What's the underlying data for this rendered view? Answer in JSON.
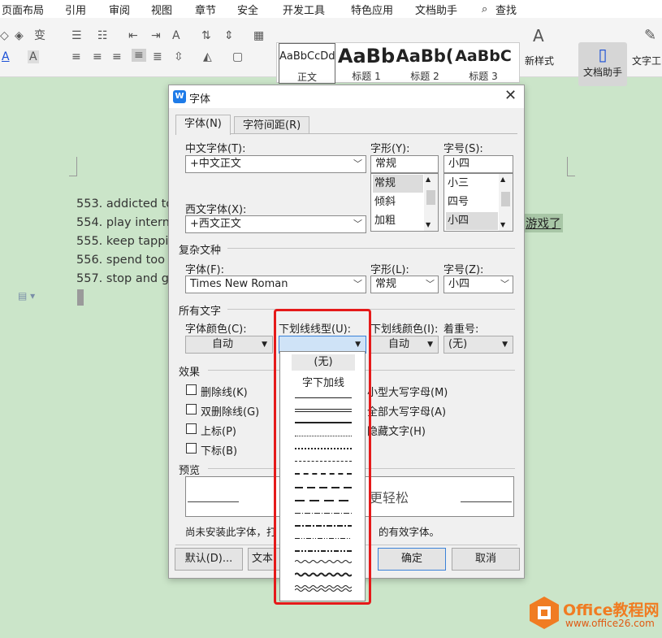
{
  "menu": [
    "页面布局",
    "引用",
    "审阅",
    "视图",
    "章节",
    "安全",
    "开发工具",
    "特色应用",
    "文档助手",
    "查找"
  ],
  "styles": [
    {
      "preview": "AaBbCcDd",
      "name": "正文"
    },
    {
      "preview": "AaBb",
      "name": "标题 1"
    },
    {
      "preview": "AaBb(",
      "name": "标题 2"
    },
    {
      "preview": "AaBbC",
      "name": "标题 3"
    }
  ],
  "ribbon": {
    "new_style": "新样式",
    "doc_assist": "文档助手",
    "text_tools": "文字工"
  },
  "doc_lines": [
    "553. addicted to",
    "554. play interne",
    "555. keep tappin",
    "556. spend too n",
    "557. stop and go"
  ],
  "doc_suffix": "游戏了",
  "dialog": {
    "title": "字体",
    "tabs": [
      "字体(N)",
      "字符间距(R)"
    ],
    "cn_font_label": "中文字体(T):",
    "cn_font_value": "+中文正文",
    "style_label": "字形(Y):",
    "style_value": "常规",
    "style_list": [
      "常规",
      "倾斜",
      "加粗"
    ],
    "size_label": "字号(S):",
    "size_value": "小四",
    "size_list": [
      "小三",
      "四号",
      "小四"
    ],
    "west_font_label": "西文字体(X):",
    "west_font_value": "+西文正文",
    "complex_section": "复杂文种",
    "complex_font_label": "字体(F):",
    "complex_font_value": "Times New Roman",
    "complex_style_label": "字形(L):",
    "complex_style_value": "常规",
    "complex_size_label": "字号(Z):",
    "complex_size_value": "小四",
    "all_text_section": "所有文字",
    "color_label": "字体颜色(C):",
    "color_value": "自动",
    "underline_label": "下划线线型(U):",
    "underline_color_label": "下划线颜色(I):",
    "underline_color_value": "自动",
    "emphasis_label": "着重号:",
    "emphasis_value": "(无)",
    "effects_section": "效果",
    "effects_left": [
      "删除线(K)",
      "双删除线(G)",
      "上标(P)",
      "下标(B)"
    ],
    "effects_right": [
      "小型大写字母(M)",
      "全部大写字母(A)",
      "隐藏文字(H)"
    ],
    "preview_section": "预览",
    "preview_text": "更轻松",
    "note": "尚未安装此字体，打",
    "note_tail": "的有效字体。",
    "default_button": "默认(D)...",
    "text_effect_button": "文本",
    "ok_button": "确定",
    "cancel_button": "取消"
  },
  "underline_dropdown": {
    "options_text": [
      "(无)",
      "字下加线"
    ],
    "line_styles": [
      "solid",
      "double",
      "thick",
      "dotted",
      "dotted-thick",
      "dashed",
      "dashed-thick",
      "long-dash",
      "dash-dot",
      "dash-dot-thick",
      "dash-dot-dot",
      "dash-dot-dot-thick",
      "wave",
      "wave-thick",
      "double-wave"
    ]
  },
  "watermark": {
    "brand": "Office教程网",
    "url": "www.office26.com"
  }
}
